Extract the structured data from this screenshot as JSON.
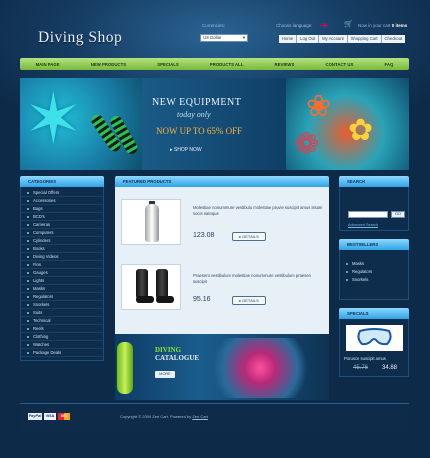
{
  "header": {
    "logo": "Diving Shop",
    "currencies_label": "Currencies:",
    "currency_selected": "US Dollar",
    "language_label": "Choose language:",
    "cart_prefix": "Now in your cart",
    "cart_items": "0 items",
    "top_links": [
      "Home",
      "Log Out",
      "My Account",
      "Shopping Cart",
      "Checkout"
    ]
  },
  "nav": {
    "items": [
      "MAIN PAGE",
      "NEW PRODUCTS",
      "SPECIALS",
      "PRODUCTS ALL",
      "REVIEWS",
      "CONTACT US",
      "FAQ"
    ]
  },
  "banner": {
    "title": "NEW EQUIPMENT",
    "subtitle": "today only",
    "offer": "NOW UP TO 65% OFF",
    "shop_now": "SHOP NOW"
  },
  "categories": {
    "title": "CATEGORIES",
    "items": [
      "Special Offers",
      "Accessories",
      "Bags",
      "BCD's",
      "Cameras",
      "Computers",
      "Cylinders",
      "Books",
      "Diving Videos",
      "Fins",
      "Gauges",
      "Lights",
      "Masks",
      "Regulators",
      "Snorkels",
      "Suits",
      "Technical",
      "Reels",
      "Clothing",
      "Watches",
      "Package Deals"
    ]
  },
  "featured": {
    "title": "FEATURED PRODUCTS",
    "products": [
      {
        "desc": "Molestiae nonummure vestibulu molestiae pruvie suscipit amus issam socis natoque",
        "price": "123.08",
        "details": "DETAILS"
      },
      {
        "desc": "Praesent vestibulum molestiae nonummure vestibulum praesen suscipit",
        "price": "95.16",
        "details": "DETAILS"
      }
    ]
  },
  "promo": {
    "diving": "DIVING",
    "catalogue": "CATALOGUE",
    "more": "MORE"
  },
  "search": {
    "title": "SEARCH",
    "go": "GO",
    "advanced": "Advanced Search"
  },
  "bestsellers": {
    "title": "BESTSELLERS",
    "items": [
      "Masks",
      "Regulators",
      "Snorkels"
    ]
  },
  "specials": {
    "title": "SPECIALS",
    "name": "Porusce suscipit amus",
    "old_price": "45.76",
    "new_price": "34.88"
  },
  "footer": {
    "paypal": "PayPal",
    "visa": "VISA",
    "mastercard": "MC",
    "copyright": "Copyright © 2009 Zen Cart. Powered by",
    "powered_link": "Zen Cart"
  }
}
